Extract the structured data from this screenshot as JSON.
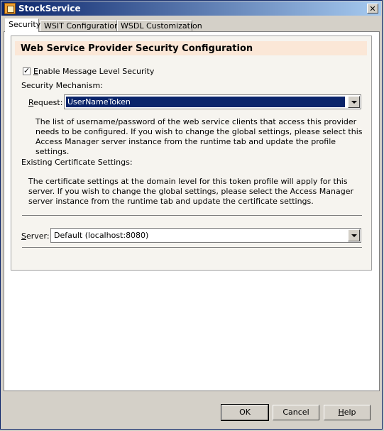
{
  "window": {
    "title": "StockService",
    "close_symbol": "✕"
  },
  "tabs": [
    {
      "label": "Security"
    },
    {
      "label": "WSIT Configuration"
    },
    {
      "label": "WSDL Customization"
    }
  ],
  "panel": {
    "header": "Web Service Provider Security Configuration",
    "enable_message_security": {
      "label_prefix": "E",
      "label_rest": "nable Message Level Security",
      "checked": true
    },
    "security_mechanism_label": "Security Mechanism:",
    "request": {
      "label_prefix": "R",
      "label_rest": "equest:",
      "value": "UserNameToken"
    },
    "request_info": "The list of username/password of the web service clients that access this provider needs to be configured. If you wish to change the global settings, please select this Access Manager server instance from the runtime tab and update the profile settings.",
    "existing_cert_label": "Existing Certificate Settings:",
    "cert_info": "The certificate settings at the domain level for this token profile will apply for this server. If you wish to change the global settings, please select the Access Manager server instance from the runtime tab and update the certificate settings.",
    "server": {
      "label_prefix": "S",
      "label_rest": "erver:",
      "value": "Default (localhost:8080)"
    }
  },
  "buttons": {
    "ok": "OK",
    "cancel": "Cancel",
    "help_prefix": "H",
    "help_rest": "elp"
  }
}
